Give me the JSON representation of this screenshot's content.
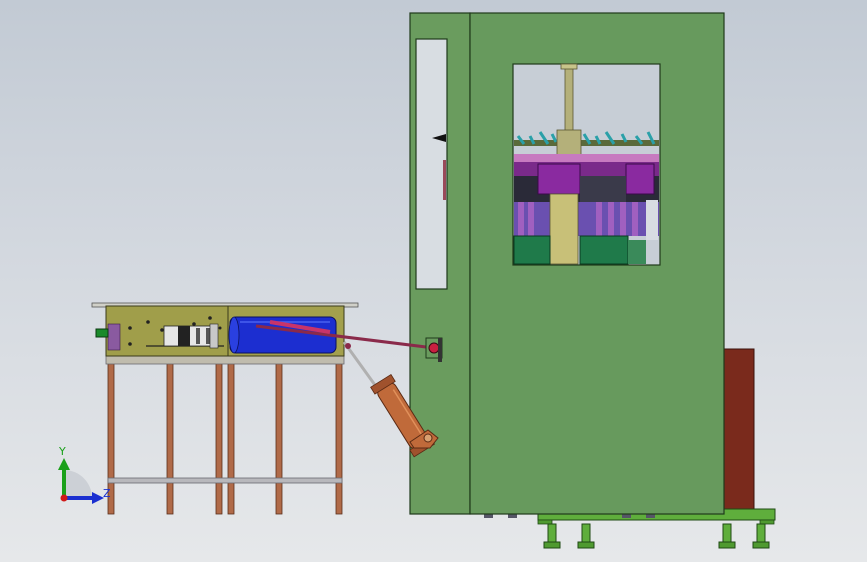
{
  "triad": {
    "y_label": "Y",
    "z_label": "Z",
    "y_color": "#1aa01a",
    "z_color": "#1a2fd0",
    "origin_color": "#d01818"
  },
  "colors": {
    "cabinet_green": "#659a5c",
    "cabinet_edge": "#1f3a1a",
    "base_green": "#5fae3c",
    "bench_top": "#9f9d48",
    "leg_copper": "#b06a48",
    "cylinder_blue": "#1c2ed0",
    "actuator_orange": "#c06a3a",
    "rear_panel": "#7a2a1c"
  }
}
